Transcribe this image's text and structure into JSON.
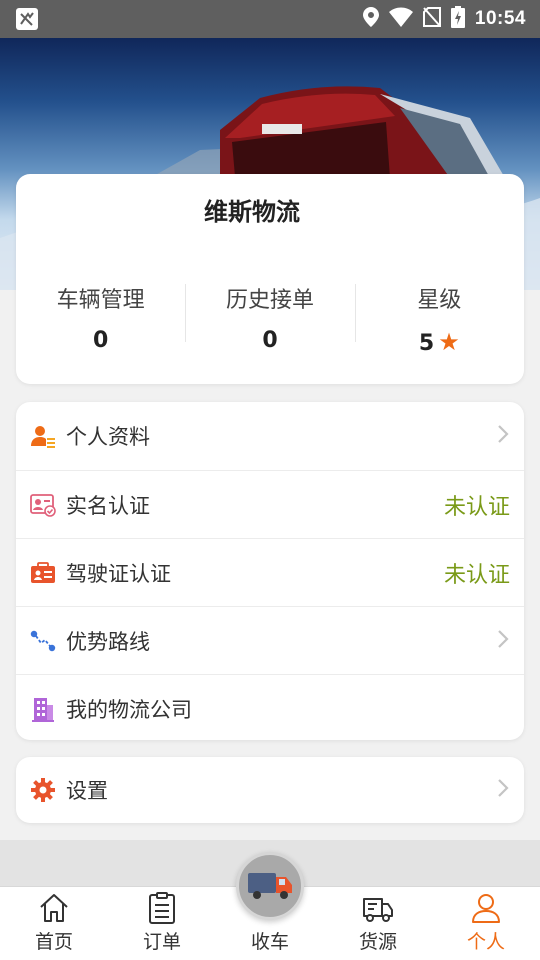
{
  "status_bar": {
    "time": "10:54"
  },
  "profile": {
    "company_name": "维斯物流",
    "stats": [
      {
        "label": "车辆管理",
        "value": "0"
      },
      {
        "label": "历史接单",
        "value": "0"
      },
      {
        "label": "星级",
        "value": "5",
        "star": "★"
      }
    ]
  },
  "menu": {
    "items": [
      {
        "label": "个人资料",
        "icon": "person-info-icon"
      },
      {
        "label": "实名认证",
        "icon": "id-card-icon",
        "status": "未认证"
      },
      {
        "label": "驾驶证认证",
        "icon": "license-icon",
        "status": "未认证"
      },
      {
        "label": "优势路线",
        "icon": "route-icon"
      },
      {
        "label": "我的物流公司",
        "icon": "building-icon"
      }
    ],
    "settings_label": "设置"
  },
  "tabs": [
    {
      "label": "首页",
      "icon": "home-icon"
    },
    {
      "label": "订单",
      "icon": "order-icon"
    },
    {
      "label": "收车",
      "icon": "truck-icon"
    },
    {
      "label": "货源",
      "icon": "cargo-truck-icon"
    },
    {
      "label": "个人",
      "icon": "person-icon",
      "active": true
    }
  ],
  "colors": {
    "accent": "#ee6b16",
    "status_unverified": "#7a9a18",
    "status_bar": "#5f5f5f"
  }
}
